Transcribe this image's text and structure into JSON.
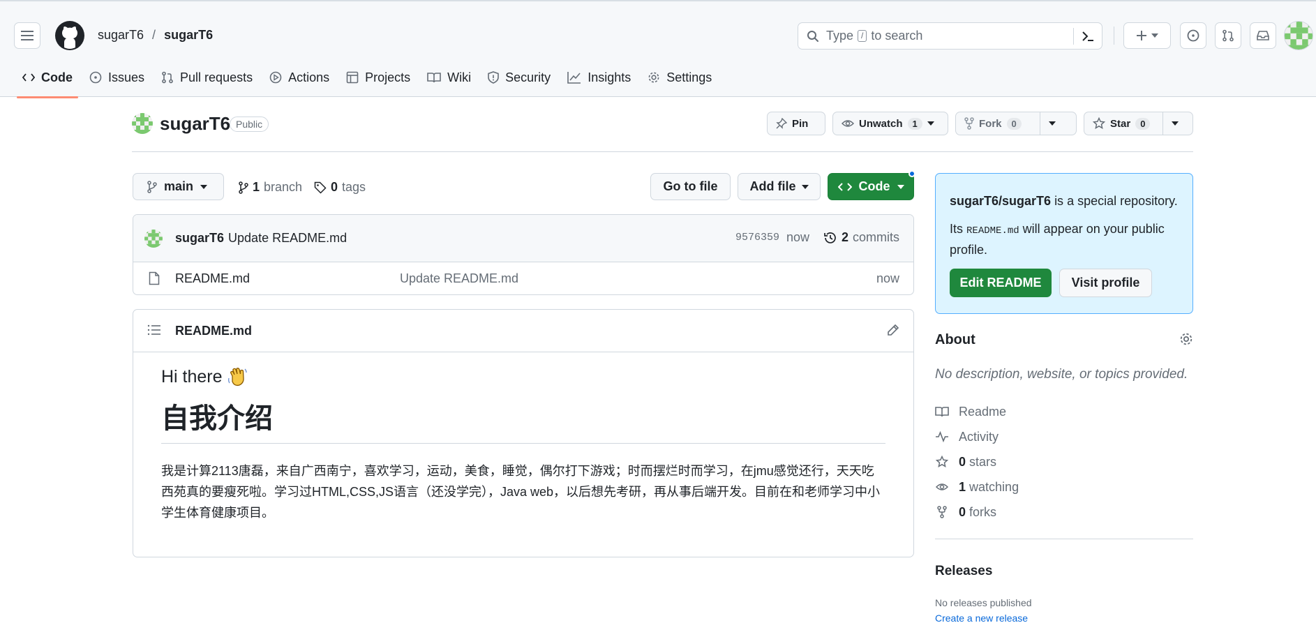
{
  "header": {
    "owner": "sugarT6",
    "separator": "/",
    "repo": "sugarT6",
    "search_prefix": "Type",
    "search_key": "/",
    "search_suffix": "to search"
  },
  "tabs": [
    {
      "label": "Code",
      "icon": "code-icon"
    },
    {
      "label": "Issues",
      "icon": "issue-icon"
    },
    {
      "label": "Pull requests",
      "icon": "pull-request-icon"
    },
    {
      "label": "Actions",
      "icon": "play-icon"
    },
    {
      "label": "Projects",
      "icon": "table-icon"
    },
    {
      "label": "Wiki",
      "icon": "book-icon"
    },
    {
      "label": "Security",
      "icon": "shield-icon"
    },
    {
      "label": "Insights",
      "icon": "graph-icon"
    },
    {
      "label": "Settings",
      "icon": "gear-icon"
    }
  ],
  "repo_head": {
    "name": "sugarT6",
    "visibility": "Public",
    "pin_label": "Pin",
    "unwatch_label": "Unwatch",
    "watch_count": "1",
    "fork_label": "Fork",
    "fork_count": "0",
    "star_label": "Star",
    "star_count": "0"
  },
  "branch_bar": {
    "branch": "main",
    "branch_count": "1",
    "branch_word": "branch",
    "tag_count": "0",
    "tag_word": "tags",
    "go_to_file": "Go to file",
    "add_file": "Add file",
    "code": "Code"
  },
  "commit": {
    "author": "sugarT6",
    "message": "Update README.md",
    "sha": "9576359",
    "age": "now",
    "commit_count": "2",
    "commit_word": "commits"
  },
  "files": [
    {
      "name": "README.md",
      "message": "Update README.md",
      "age": "now"
    }
  ],
  "readme": {
    "title": "README.md",
    "greeting": "Hi there",
    "heading": "自我介绍",
    "paragraph": "我是计算2113唐磊，来自广西南宁，喜欢学习，运动，美食，睡觉，偶尔打下游戏；时而摆烂时而学习，在jmu感觉还行，天天吃西苑真的要瘦死啦。学习过HTML,CSS,JS语言（还没学完），Java web，以后想先考研，再从事后端开发。目前在和老师学习中小学生体育健康项目。"
  },
  "special": {
    "repo": "sugarT6/sugarT6",
    "is_special": "is a special repository.",
    "its": "Its",
    "file": "README.md",
    "appear": "will appear on your public profile.",
    "edit_label": "Edit README",
    "visit_label": "Visit profile"
  },
  "about": {
    "title": "About",
    "description": "No description, website, or topics provided.",
    "readme": "Readme",
    "activity": "Activity",
    "stars_count": "0",
    "stars_word": "stars",
    "watching_count": "1",
    "watching_word": "watching",
    "forks_count": "0",
    "forks_word": "forks"
  },
  "releases": {
    "title": "Releases",
    "none": "No releases published",
    "create": "Create a new release"
  },
  "colors": {
    "green": "#1f883d",
    "accent_underline": "#fd8c73",
    "link": "#0969da",
    "special_bg": "#ddf4ff"
  }
}
